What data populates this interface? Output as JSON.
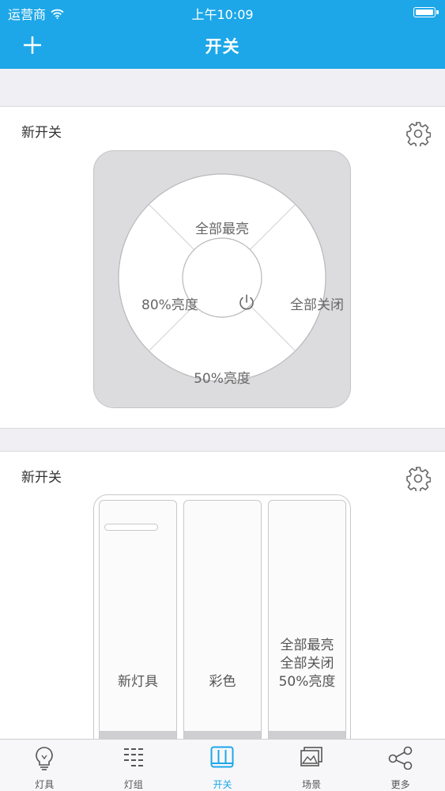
{
  "status_bar": {
    "carrier": "运营商",
    "time": "上午10:09"
  },
  "header": {
    "title": "开关",
    "add_icon": "plus-icon",
    "color": "#1da7e8"
  },
  "switches": [
    {
      "title": "新开关",
      "type": "dial",
      "buttons": {
        "top": "全部最亮",
        "right": "全部关闭",
        "bottom": "50%亮度",
        "left": "80%亮度"
      },
      "center_icon": "power-icon"
    },
    {
      "title": "新开关",
      "type": "panel",
      "keys": [
        {
          "label": "新灯具"
        },
        {
          "label": "彩色"
        },
        {
          "lines": [
            "全部最亮",
            "全部关闭",
            "50%亮度"
          ]
        }
      ]
    }
  ],
  "tabs": [
    {
      "label": "灯具",
      "icon": "bulb-icon"
    },
    {
      "label": "灯组",
      "icon": "group-icon"
    },
    {
      "label": "开关",
      "icon": "switch-icon",
      "active": true
    },
    {
      "label": "场景",
      "icon": "scene-icon"
    },
    {
      "label": "更多",
      "icon": "share-icon"
    }
  ],
  "colors": {
    "accent": "#1da7e8",
    "background": "#efeff4"
  }
}
